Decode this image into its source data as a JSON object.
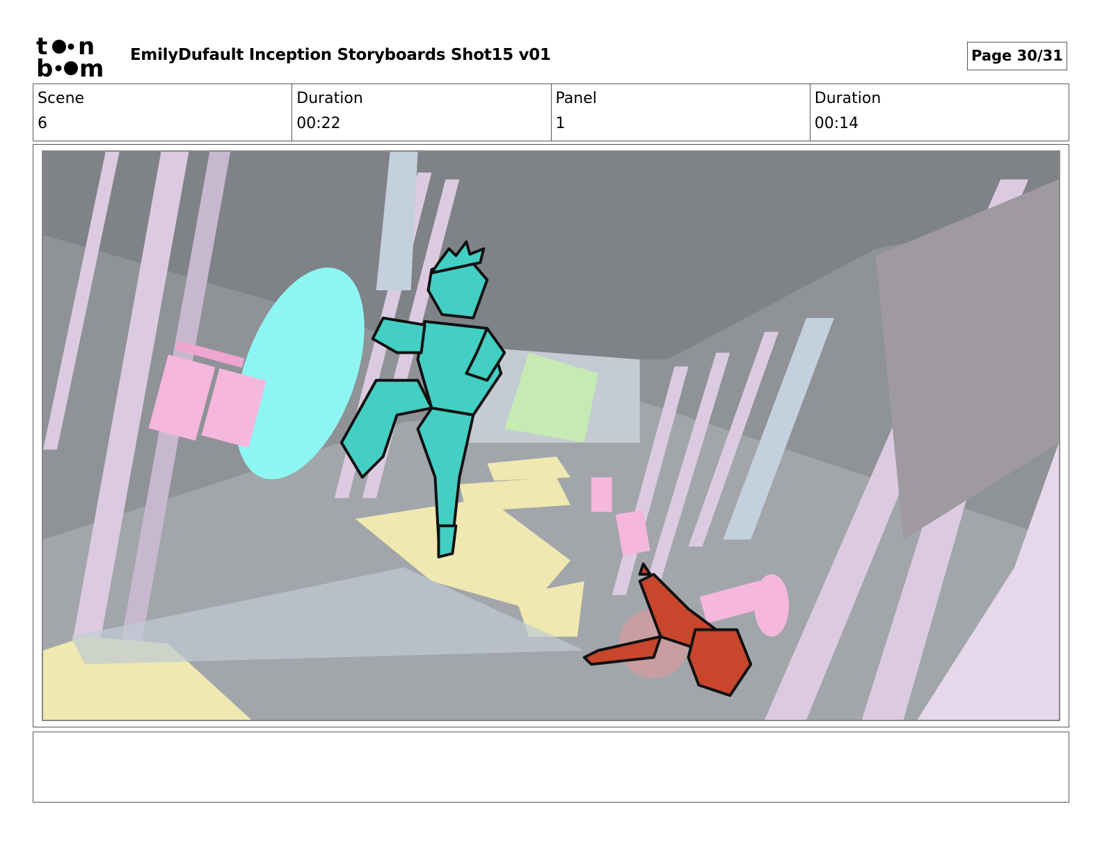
{
  "header": {
    "logo_text": "toonboom",
    "title": "EmilyDufault Inception Storyboards Shot15 v01",
    "page_label": "Page 30/31"
  },
  "info": {
    "scene_label": "Scene",
    "scene_value": "6",
    "scene_duration_label": "Duration",
    "scene_duration_value": "00:22",
    "panel_label": "Panel",
    "panel_value": "1",
    "panel_duration_label": "Duration",
    "panel_duration_value": "00:14"
  },
  "panel": {
    "image_icon": "storyboard-sketch",
    "colors": {
      "hero": "#44cfc4",
      "fallen_figure": "#c8462c",
      "wall_lavender": "#dccbe0",
      "door_pink": "#f6b7dc",
      "glow_cyan": "#8ef6f2",
      "floor_yellow": "#efe8b0",
      "window_green": "#c6eab4"
    }
  },
  "notes": {
    "action_notes": ""
  }
}
